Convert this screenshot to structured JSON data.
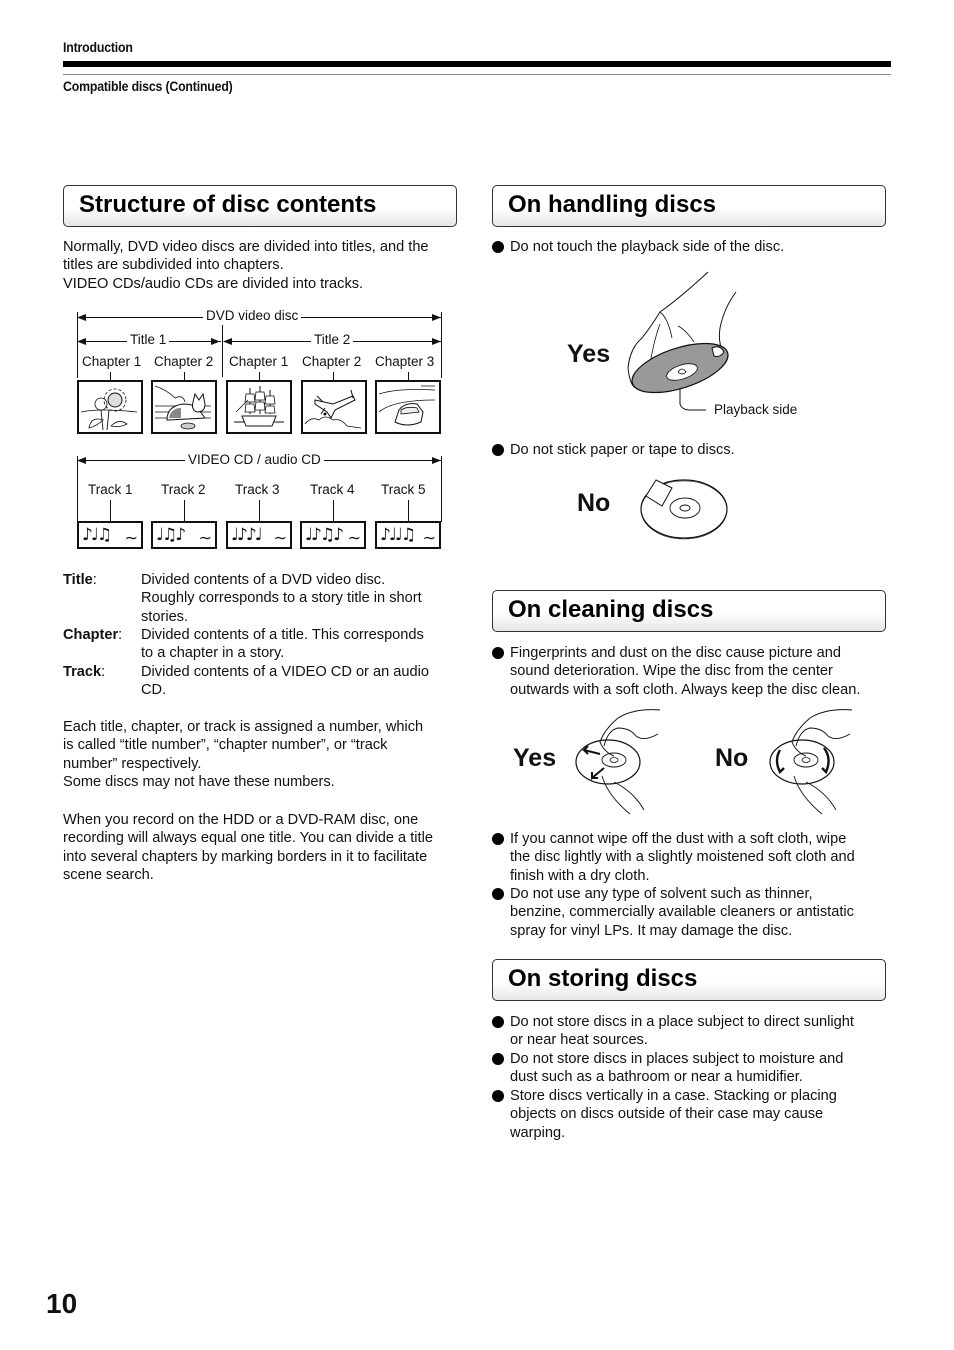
{
  "header": {
    "section": "Introduction",
    "subsection": "Compatible discs (Continued)"
  },
  "page_number": "10",
  "structure": {
    "title": "Structure of disc contents",
    "intro": [
      "Normally, DVD video discs are divided into titles, and the",
      "titles are subdivided into chapters.",
      "VIDEO CDs/audio CDs are divided into tracks."
    ],
    "dvd_diagram": {
      "label": "DVD video disc",
      "titles": [
        {
          "label": "Title 1",
          "chapters": [
            "Chapter 1",
            "Chapter 2"
          ]
        },
        {
          "label": "Title 2",
          "chapters": [
            "Chapter 1",
            "Chapter 2",
            "Chapter 3"
          ]
        }
      ],
      "thumbnails": [
        "sunflower-picture",
        "cat-picture",
        "sailing-ship-picture",
        "airplane-picture",
        "car-picture"
      ]
    },
    "cd_diagram": {
      "label": "VIDEO CD / audio CD",
      "tracks": [
        {
          "label": "Track 1",
          "notes": "♪♩♫",
          "wave": "∼"
        },
        {
          "label": "Track 2",
          "notes": "♩♫♪",
          "wave": "∼"
        },
        {
          "label": "Track 3",
          "notes": "♩♪♪♩",
          "wave": "∼"
        },
        {
          "label": "Track 4",
          "notes": "♩♪♫♪",
          "wave": "∼"
        },
        {
          "label": "Track 5",
          "notes": "♪♩♩♫",
          "wave": "∼"
        }
      ]
    },
    "definitions": [
      {
        "term": "Title",
        "lines": [
          "Divided contents of a DVD video disc.",
          "Roughly corresponds to a story title in short",
          "stories."
        ]
      },
      {
        "term": "Chapter",
        "lines": [
          "Divided contents of a title. This corresponds",
          "to a chapter in a story."
        ]
      },
      {
        "term": "Track",
        "lines": [
          "Divided contents of a VIDEO CD or an audio",
          "CD."
        ]
      }
    ],
    "para1": [
      "Each title, chapter, or track is assigned a number, which",
      "is called “title number”, “chapter number”, or “track",
      "number” respectively.",
      "Some discs may not have these numbers."
    ],
    "para2": [
      "When you record on the HDD or a DVD-RAM disc, one",
      "recording will always equal one title. You can divide a title",
      "into several chapters by marking borders in it to facilitate",
      "scene search."
    ]
  },
  "handling": {
    "title": "On handling discs",
    "bullet1": "Do not touch the playback side of the disc.",
    "yes_label": "Yes",
    "playback_side_label": "Playback side",
    "bullet2": "Do not stick paper or tape to discs.",
    "no_label": "No"
  },
  "cleaning": {
    "title": "On cleaning discs",
    "bullet1": [
      "Fingerprints and dust on the disc cause picture and",
      "sound deterioration. Wipe the disc from the center",
      "outwards with a soft cloth. Always keep the disc clean."
    ],
    "yes_label": "Yes",
    "no_label": "No",
    "bullet2": [
      "If you cannot wipe off the dust with a soft cloth, wipe",
      "the disc lightly with a slightly moistened soft cloth and",
      "finish with a dry cloth."
    ],
    "bullet3": [
      "Do not use any type of solvent such as thinner,",
      "benzine, commercially available cleaners or antistatic",
      "spray for vinyl LPs. It may damage the disc."
    ]
  },
  "storing": {
    "title": "On storing discs",
    "bullets": [
      [
        "Do not store discs in a place subject to direct sunlight",
        "or near heat sources."
      ],
      [
        "Do not store discs in places subject to moisture and",
        "dust such as a bathroom or near a humidifier."
      ],
      [
        "Store discs vertically in a case. Stacking or placing",
        "objects on discs outside of their case may cause",
        "warping."
      ]
    ]
  }
}
